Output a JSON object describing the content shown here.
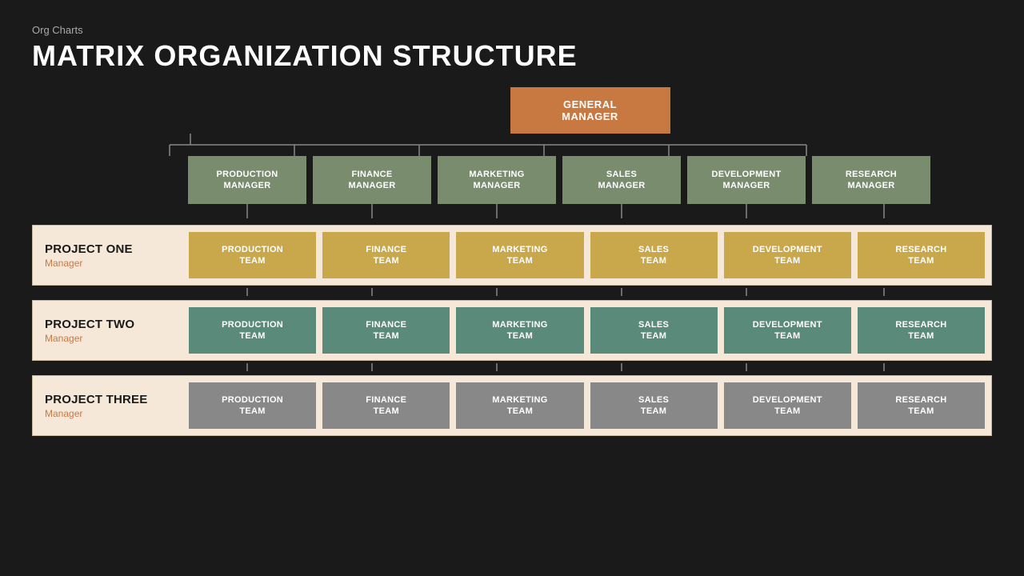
{
  "page": {
    "subtitle": "Org Charts",
    "title": "MATRIX ORGANIZATION STRUCTURE"
  },
  "gm": {
    "label": "GENERAL MANAGER"
  },
  "managers": [
    {
      "label": "PRODUCTION\nMANAGER"
    },
    {
      "label": "FINANCE\nMANAGER"
    },
    {
      "label": "MARKETING\nMANAGER"
    },
    {
      "label": "SALES\nMANAGER"
    },
    {
      "label": "DEVELOPMENT\nMANAGER"
    },
    {
      "label": "RESEARCH\nMANAGER"
    }
  ],
  "projects": [
    {
      "name": "PROJECT ONE",
      "manager_label": "Manager",
      "color_class": "team-gold",
      "teams": [
        "PRODUCTION\nTEAM",
        "FINANCE\nTEAM",
        "MARKETING\nTEAM",
        "SALES\nTEAM",
        "DEVELOPMENT\nTEAM",
        "RESEARCH\nTEAM"
      ]
    },
    {
      "name": "PROJECT TWO",
      "manager_label": "Manager",
      "color_class": "team-teal",
      "teams": [
        "PRODUCTION\nTEAM",
        "FINANCE\nTEAM",
        "MARKETING\nTEAM",
        "SALES\nTEAM",
        "DEVELOPMENT\nTEAM",
        "RESEARCH\nTEAM"
      ]
    },
    {
      "name": "PROJECT THREE",
      "manager_label": "Manager",
      "color_class": "team-gray",
      "teams": [
        "PRODUCTION\nTEAM",
        "FINANCE\nTEAM",
        "MARKETING\nTEAM",
        "SALES\nTEAM",
        "DEVELOPMENT\nTEAM",
        "RESEARCH\nTEAM"
      ]
    }
  ]
}
